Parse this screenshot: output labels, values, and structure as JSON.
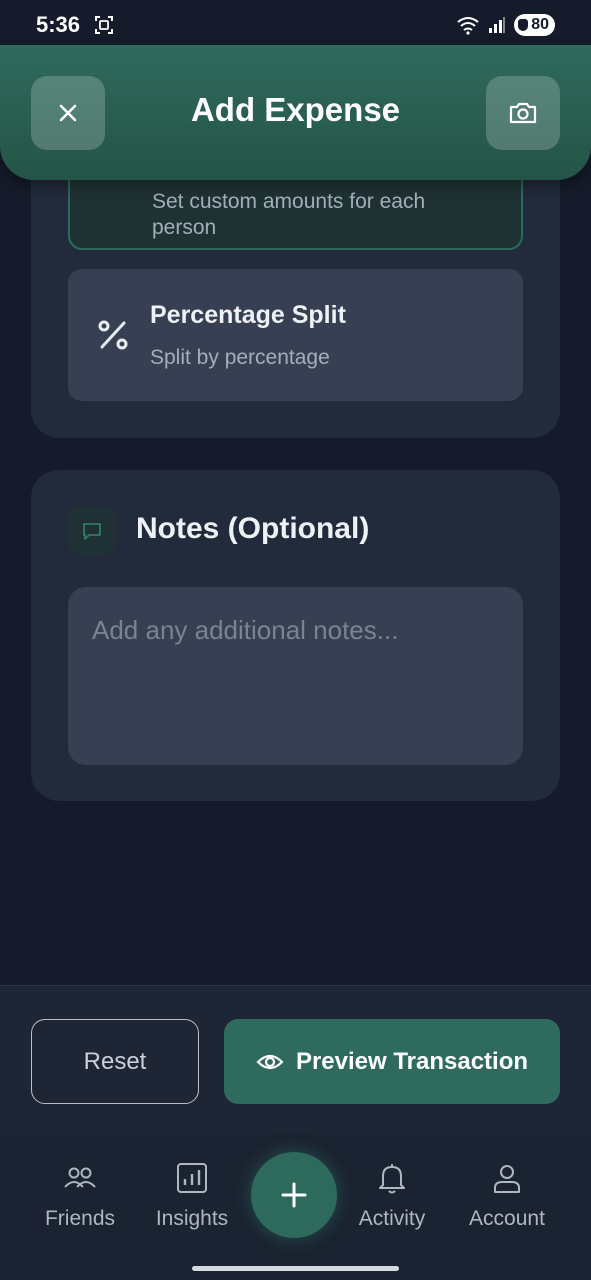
{
  "status_bar": {
    "time": "5:36",
    "battery": "80"
  },
  "header": {
    "title": "Add Expense"
  },
  "split_options": {
    "custom": {
      "subtitle_line1": "Set custom amounts for each",
      "subtitle_line2": "person"
    },
    "percentage": {
      "title": "Percentage Split",
      "subtitle": "Split by percentage"
    }
  },
  "notes": {
    "title": "Notes (Optional)",
    "placeholder": "Add any additional notes..."
  },
  "actions": {
    "reset_label": "Reset",
    "preview_label": "Preview Transaction"
  },
  "nav": {
    "friends": "Friends",
    "insights": "Insights",
    "activity": "Activity",
    "account": "Account"
  },
  "colors": {
    "accent": "#2e6a5d",
    "background": "#151b2b",
    "card": "#222b3b"
  }
}
